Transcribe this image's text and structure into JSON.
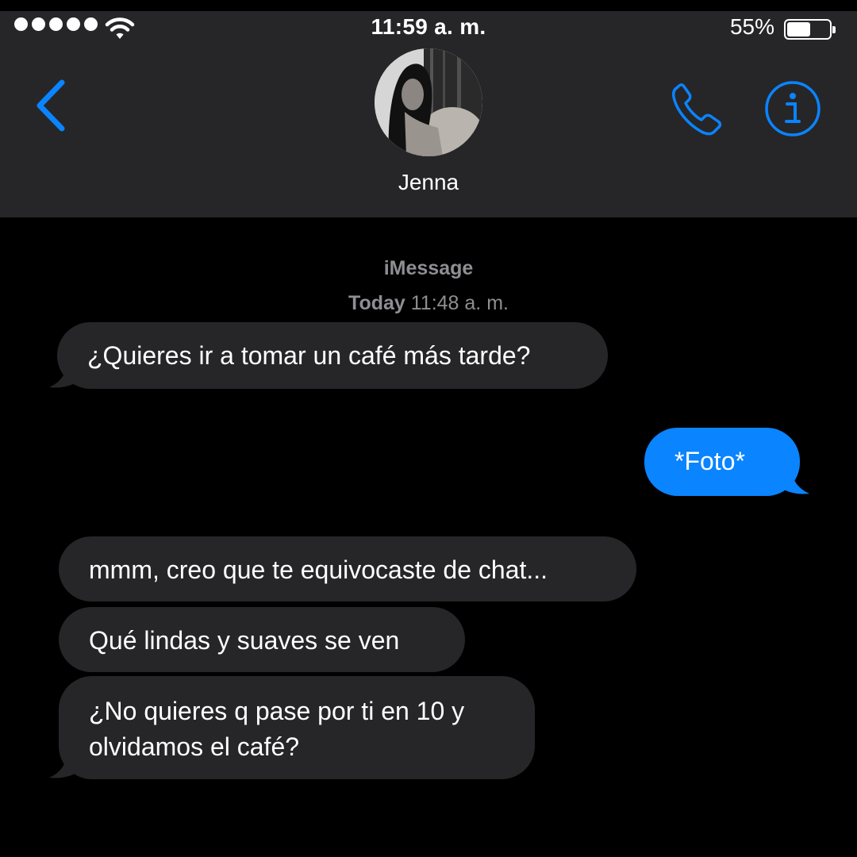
{
  "status_bar": {
    "time": "11:59 a. m.",
    "battery_percent": "55%",
    "battery_level": 0.55,
    "signal_bars": 5
  },
  "nav": {
    "back_icon": "chevron-left-icon",
    "call_icon": "phone-icon",
    "info_icon": "info-icon",
    "contact_name": "Jenna"
  },
  "conversation": {
    "service_label": "iMessage",
    "timestamp_day": "Today",
    "timestamp_time": "11:48 a. m.",
    "messages": [
      {
        "direction": "incoming",
        "text": "¿Quieres ir a tomar un café más tarde?"
      },
      {
        "direction": "outgoing",
        "text": "*Foto*"
      },
      {
        "direction": "incoming",
        "text": "mmm, creo que te equivocaste de chat..."
      },
      {
        "direction": "incoming",
        "text": "Qué lindas y suaves se ven"
      },
      {
        "direction": "incoming",
        "text": "¿No quieres q pase por ti en 10 y olvidamos el café?",
        "lines": [
          "¿No quieres q pase por ti en 10 y",
          "olvidamos el café?"
        ]
      }
    ]
  },
  "colors": {
    "accent": "#0a84ff",
    "header_bg": "#262628",
    "incoming_bubble": "#262628",
    "background": "#000000",
    "secondary_text": "#8e8e93"
  }
}
